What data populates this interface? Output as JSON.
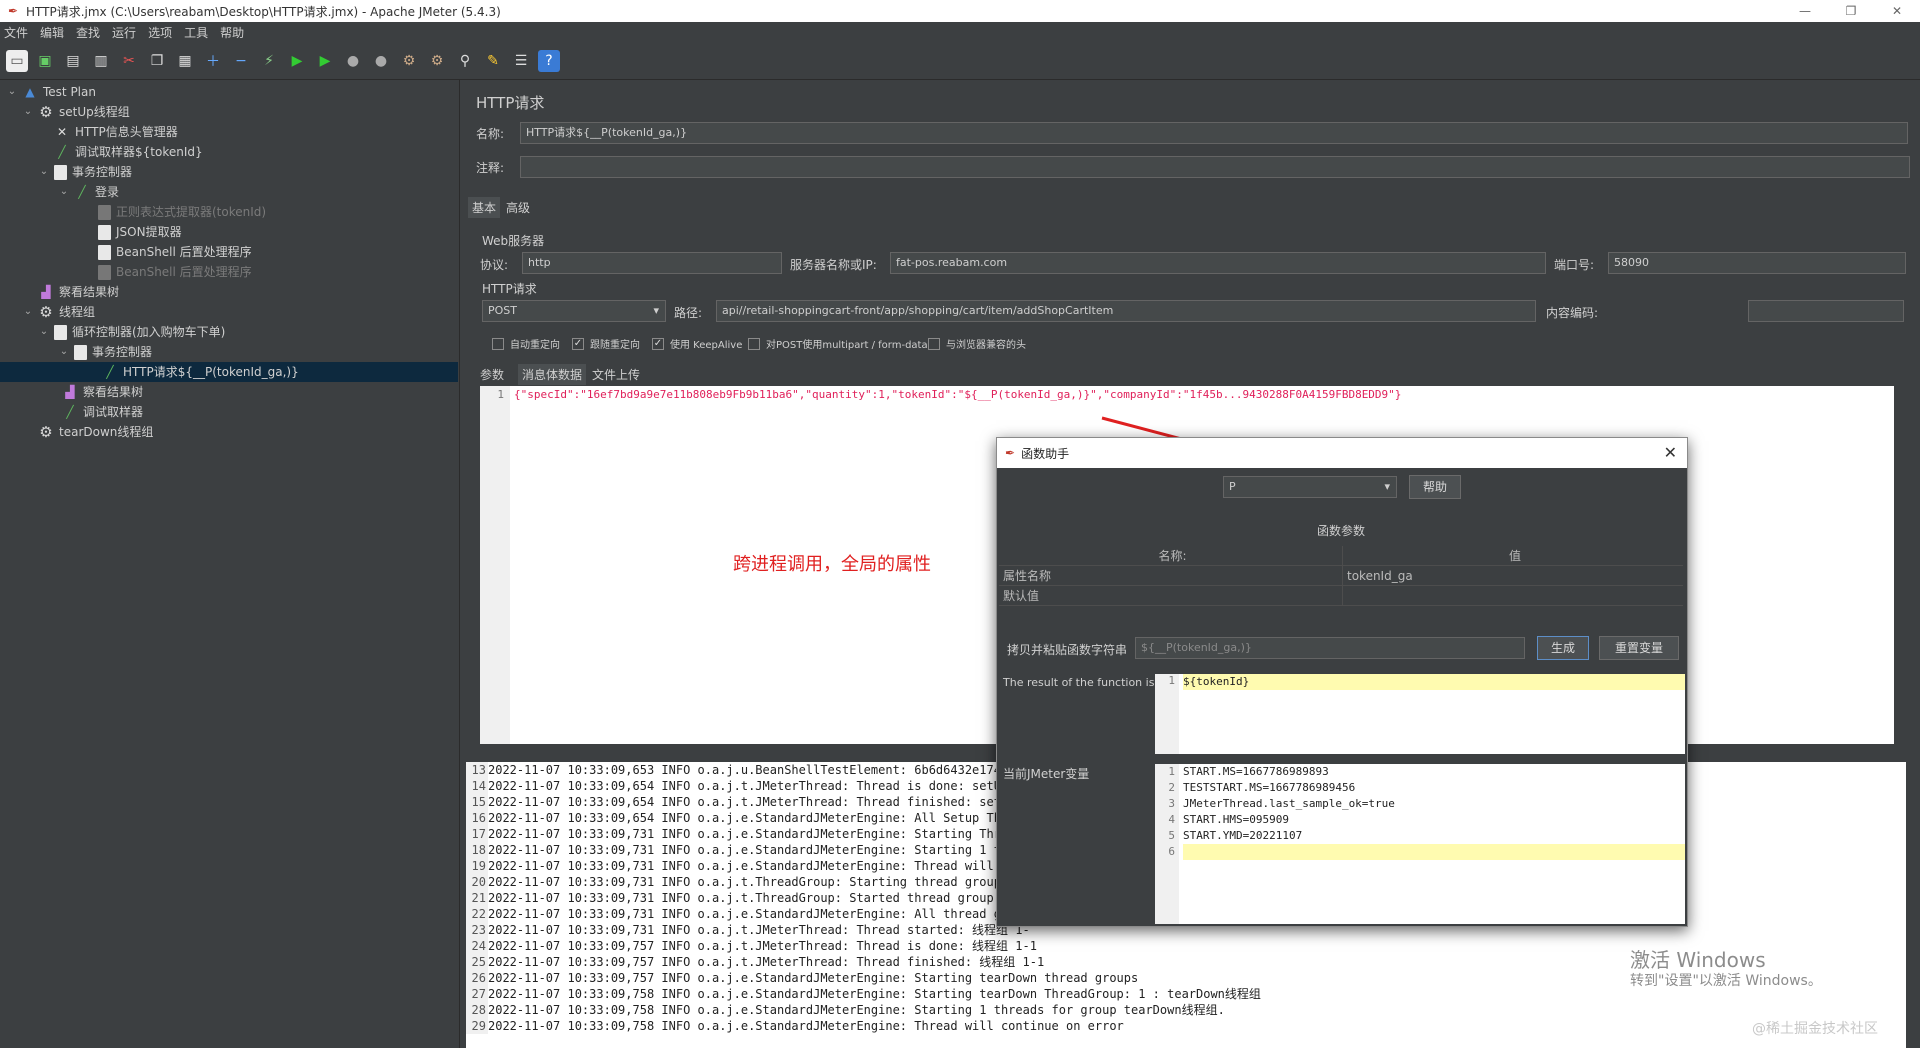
{
  "window": {
    "title": "HTTP请求.jmx (C:\\Users\\reabam\\Desktop\\HTTP请求.jmx) - Apache JMeter (5.4.3)"
  },
  "menu": [
    "文件",
    "编辑",
    "查找",
    "运行",
    "选项",
    "工具",
    "帮助"
  ],
  "tree": [
    {
      "label": "Test Plan",
      "icon": "test-plan-icon"
    },
    {
      "label": "setUp线程组",
      "icon": "gear-icon"
    },
    {
      "label": "HTTP信息头管理器",
      "icon": "tools-icon"
    },
    {
      "label": "调试取样器${tokenId}",
      "icon": "pen-icon"
    },
    {
      "label": "事务控制器",
      "icon": "doc-icon"
    },
    {
      "label": "登录",
      "icon": "pen-icon"
    },
    {
      "label": "正则表达式提取器(tokenId)",
      "icon": "doc-icon"
    },
    {
      "label": "JSON提取器",
      "icon": "doc-icon"
    },
    {
      "label": "BeanShell 后置处理程序",
      "icon": "doc-icon"
    },
    {
      "label": "BeanShell 后置处理程序",
      "icon": "doc-icon"
    },
    {
      "label": "察看结果树",
      "icon": "chart-icon"
    },
    {
      "label": "线程组",
      "icon": "gear-icon"
    },
    {
      "label": "循环控制器(加入购物车下单)",
      "icon": "doc-icon"
    },
    {
      "label": "事务控制器",
      "icon": "doc-icon"
    },
    {
      "label": "HTTP请求${__P(tokenId_ga,)}",
      "icon": "pen-icon"
    },
    {
      "label": "察看结果树",
      "icon": "chart-icon"
    },
    {
      "label": "调试取样器",
      "icon": "pen-icon"
    },
    {
      "label": "tearDown线程组",
      "icon": "gear-icon"
    }
  ],
  "panel": {
    "title": "HTTP请求",
    "name_label": "名称:",
    "name_value": "HTTP请求${__P(tokenId_ga,)}",
    "comment_label": "注释:",
    "tab_basic": "基本",
    "tab_advanced": "高级",
    "web_server_label": "Web服务器",
    "protocol_label": "协议:",
    "protocol_value": "http",
    "server_label": "服务器名称或IP:",
    "server_value": "fat-pos.reabam.com",
    "port_label": "端口号:",
    "port_value": "58090",
    "http_request_label": "HTTP请求",
    "method_value": "POST",
    "path_label": "路径:",
    "path_value": "api//retail-shoppingcart-front/app/shopping/cart/item/addShopCartItem",
    "encoding_label": "内容编码:",
    "checkboxes": [
      {
        "label": "自动重定向",
        "checked": false
      },
      {
        "label": "跟随重定向",
        "checked": true
      },
      {
        "label": "使用 KeepAlive",
        "checked": true
      },
      {
        "label": "对POST使用multipart / form-data",
        "checked": false
      },
      {
        "label": "与浏览器兼容的头",
        "checked": false
      }
    ],
    "subtab_params": "参数",
    "subtab_body": "消息体数据",
    "subtab_files": "文件上传",
    "body_line_no": "1",
    "body_code": "{\"specId\":\"16ef7bd9a9e7e11b808eb9Fb9b11ba6\",\"quantity\":1,\"tokenId\":\"${__P(tokenId_ga,)}\",\"companyId\":\"1f45b...9430288F0A4159FBD8EDD9\"}"
  },
  "annotation": "跨进程调用，全局的属性",
  "log_lines": [
    {
      "n": "13",
      "t": "2022-11-07 10:33:09,653 INFO o.a.j.u.BeanShellTestElement: 6b6d6432e174"
    },
    {
      "n": "14",
      "t": "2022-11-07 10:33:09,654 INFO o.a.j.t.JMeterThread: Thread is done: setUp"
    },
    {
      "n": "15",
      "t": "2022-11-07 10:33:09,654 INFO o.a.j.t.JMeterThread: Thread finished: setUp"
    },
    {
      "n": "16",
      "t": "2022-11-07 10:33:09,654 INFO o.a.j.e.StandardJMeterEngine: All Setup Thre"
    },
    {
      "n": "17",
      "t": "2022-11-07 10:33:09,731 INFO o.a.j.e.StandardJMeterEngine: Starting Threa"
    },
    {
      "n": "18",
      "t": "2022-11-07 10:33:09,731 INFO o.a.j.e.StandardJMeterEngine: Starting 1 thr"
    },
    {
      "n": "19",
      "t": "2022-11-07 10:33:09,731 INFO o.a.j.e.StandardJMeterEngine: Thread will co"
    },
    {
      "n": "20",
      "t": "2022-11-07 10:33:09,731 INFO o.a.j.t.ThreadGroup: Starting thread group..."
    },
    {
      "n": "21",
      "t": "2022-11-07 10:33:09,731 INFO o.a.j.t.ThreadGroup: Started thread group nu"
    },
    {
      "n": "22",
      "t": "2022-11-07 10:33:09,731 INFO o.a.j.e.StandardJMeterEngine: All thread gro"
    },
    {
      "n": "23",
      "t": "2022-11-07 10:33:09,731 INFO o.a.j.t.JMeterThread: Thread started: 线程组 1-"
    },
    {
      "n": "24",
      "t": "2022-11-07 10:33:09,757 INFO o.a.j.t.JMeterThread: Thread is done: 线程组 1-1"
    },
    {
      "n": "25",
      "t": "2022-11-07 10:33:09,757 INFO o.a.j.t.JMeterThread: Thread finished: 线程组 1-1"
    },
    {
      "n": "26",
      "t": "2022-11-07 10:33:09,757 INFO o.a.j.e.StandardJMeterEngine: Starting tearDown thread groups"
    },
    {
      "n": "27",
      "t": "2022-11-07 10:33:09,758 INFO o.a.j.e.StandardJMeterEngine: Starting tearDown ThreadGroup: 1 : tearDown线程组"
    },
    {
      "n": "28",
      "t": "2022-11-07 10:33:09,758 INFO o.a.j.e.StandardJMeterEngine: Starting 1 threads for group tearDown线程组."
    },
    {
      "n": "29",
      "t": "2022-11-07 10:33:09,758 INFO o.a.j.e.StandardJMeterEngine: Thread will continue on error"
    }
  ],
  "dialog": {
    "title": "函数助手",
    "function_value": "P",
    "help_label": "帮助",
    "params_label": "函数参数",
    "col_name": "名称:",
    "col_value": "值",
    "rows": [
      {
        "name": "属性名称",
        "value": "tokenId_ga"
      },
      {
        "name": "默认值",
        "value": ""
      }
    ],
    "copy_label": "拷贝并粘贴函数字符串",
    "function_string": "${__P(tokenId_ga,)}",
    "generate_label": "生成",
    "reset_label": "重置变量",
    "result_label": "The result of the function is",
    "result_line_no": "1",
    "result_value": "${tokenId}",
    "vars_label": "当前JMeter变量",
    "vars": [
      {
        "n": "1",
        "t": "START.MS=1667786989893"
      },
      {
        "n": "2",
        "t": "TESTSTART.MS=1667786989456"
      },
      {
        "n": "3",
        "t": "JMeterThread.last_sample_ok=true"
      },
      {
        "n": "4",
        "t": "START.HMS=095909"
      },
      {
        "n": "5",
        "t": "START.YMD=20221107"
      },
      {
        "n": "6",
        "t": ""
      }
    ]
  },
  "watermark": {
    "line1": "激活 Windows",
    "line2": "转到\"设置\"以激活 Windows。",
    "corner": "@稀土掘金技术社区"
  },
  "colors": {
    "background": "#3c3f41",
    "selection": "#0d293e",
    "annotation": "#e02020",
    "code_pink": "#e0205a"
  }
}
